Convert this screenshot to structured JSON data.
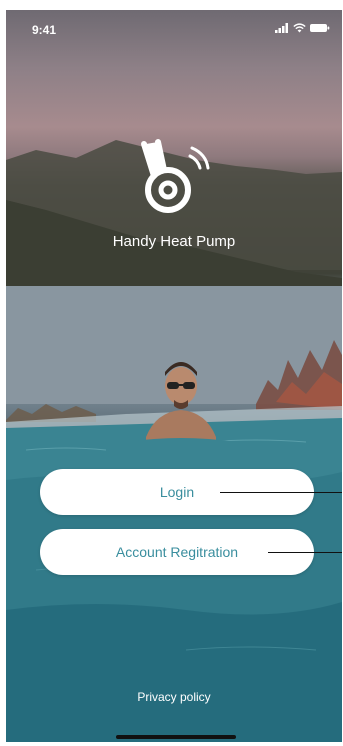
{
  "status_bar": {
    "time": "9:41",
    "icons": [
      "signal-icon",
      "wifi-icon",
      "battery-icon"
    ]
  },
  "app": {
    "name": "Handy Heat Pump",
    "logo_icon": "heat-pump-logo-icon"
  },
  "buttons": {
    "login_label": "Login",
    "register_label": "Account Regitration"
  },
  "footer": {
    "privacy_label": "Privacy policy"
  },
  "colors": {
    "button_bg": "#ffffff",
    "button_text": "#3a8e9e",
    "water": "#2f7a88",
    "sky": "#a78b8e"
  }
}
